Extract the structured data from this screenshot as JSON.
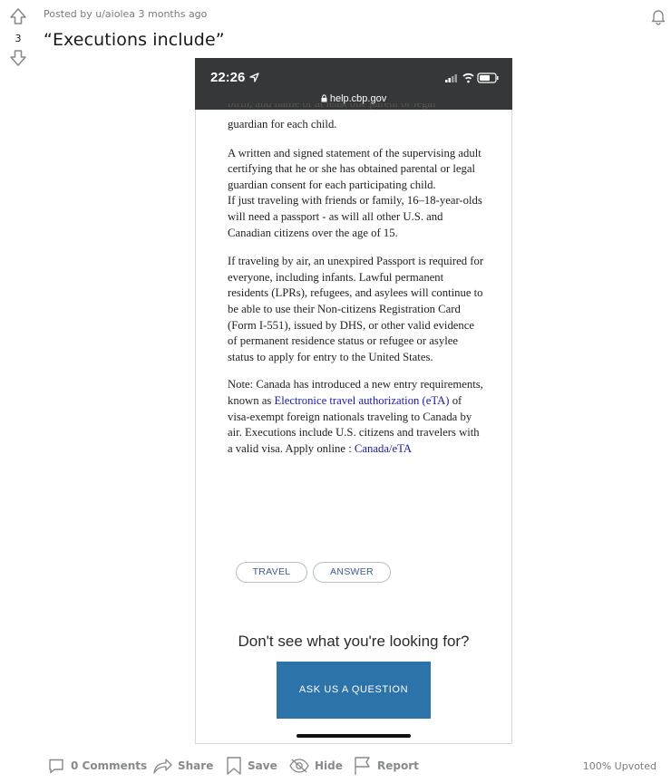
{
  "post": {
    "meta": "Posted by u/aiolea 3 months ago",
    "score": "3",
    "title": "“Executions include”"
  },
  "phone": {
    "time": "22:26",
    "url": "help.cbp.gov",
    "clipped_line": "birth, and name of at least one parent or legal",
    "p1": "guardian for each child.",
    "p2": "A written and signed statement of the supervising adult certifying that he or she has obtained parental or legal guardian consent for each participating child.",
    "p3": "If just traveling with friends or family, 16–18-year-olds will need a passport - as will all other U.S. and Canadian citizens over the age of 15.",
    "p4": "If traveling by air, an unexpired Passport is required for everyone, including infants. Lawful permanent residents (LPRs), refugees, and asylees will continue to be able to use their Non-citizens Registration Card (Form I-551), issued by DHS, or other valid evidence of permanent residence status or refugee or asylee status to apply for entry to the United States.",
    "note_a": "Note: Canada has introduced a new entry requirements, known as ",
    "note_link": "Electronice travel authorization (eTA)",
    "note_b": " of visa-exempt foreign nationals traveling to Canada by air. Executions include U.S. citizens and travelers with a valid visa. Apply online : ",
    "note_link2": "Canada/eTA",
    "tags": [
      "TRAVEL",
      "ANSWER"
    ],
    "prompt": "Don't see what you're looking for?",
    "ask_button": "ASK US A QUESTION"
  },
  "actions": {
    "comments": "0 Comments",
    "share": "Share",
    "save": "Save",
    "hide": "Hide",
    "report": "Report",
    "upvoted": "100% Upvoted"
  }
}
